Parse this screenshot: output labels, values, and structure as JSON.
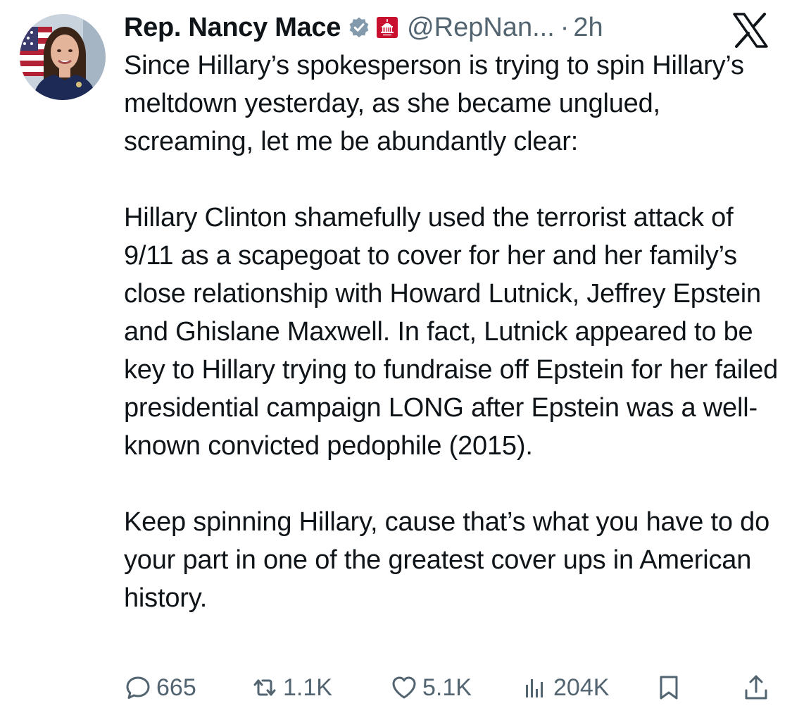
{
  "author": {
    "display_name": "Rep. Nancy Mace",
    "handle": "@RepNan...",
    "separator": "·",
    "time": "2h"
  },
  "icons": {
    "verified": "verified-badge-icon",
    "affiliation": "capitol-affiliation-icon",
    "platform": "x-logo-icon"
  },
  "colors": {
    "verified_badge": "#829aab",
    "affiliation_badge": "#c8102e",
    "text": "#0f1419",
    "secondary_text": "#536471"
  },
  "tweet": {
    "paragraphs": [
      "Since Hillary’s spokesperson is trying to spin Hillary’s meltdown yesterday, as she became unglued, screaming, let me be abundantly clear:",
      "Hillary Clinton shamefully used the terrorist attack of 9/11 as a scapegoat to cover for her and her family’s close relationship with Howard Lutnick, Jeffrey Epstein and Ghislane Maxwell. In fact, Lutnick appeared to be key to Hillary trying to fundraise off Epstein for her failed presidential campaign LONG after Epstein was a well-known convicted pedophile (2015).",
      "Keep spinning Hillary, cause that’s what you have to do your part in one of the greatest cover ups in American history."
    ]
  },
  "metrics": {
    "replies": "665",
    "reposts": "1.1K",
    "likes": "5.1K",
    "views": "204K"
  }
}
